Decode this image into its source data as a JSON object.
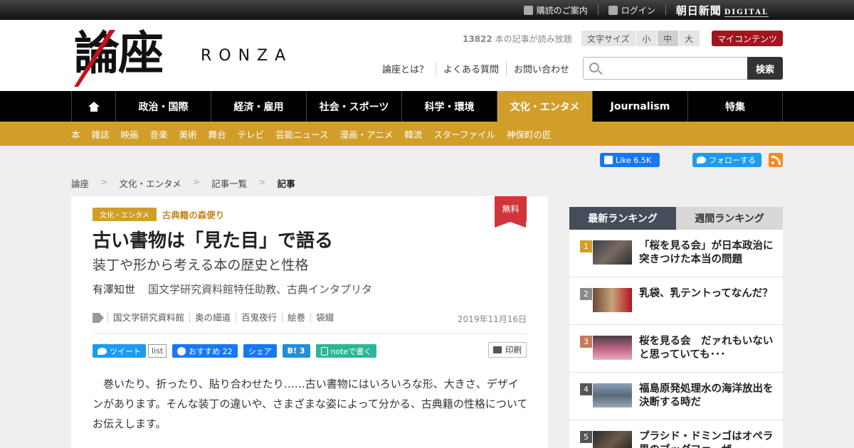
{
  "topbar": {
    "guide": "購読のご案内",
    "login": "ログイン",
    "brand": "朝日新聞",
    "brand_digital": "DIGITAL"
  },
  "header": {
    "logo_kanji": "論座",
    "logo_latin": "RONZA",
    "count_number": "13822",
    "count_text": "本の記事が読み放題",
    "fontsize_label": "文字サイズ",
    "fontsize_small": "小",
    "fontsize_medium": "中",
    "fontsize_large": "大",
    "my_contents": "マイコンテンツ",
    "links": [
      "論座とは？",
      "よくある質問",
      "お問い合わせ"
    ],
    "search_button": "検索",
    "search_placeholder": ""
  },
  "nav": {
    "items": [
      "政治・国際",
      "経済・雇用",
      "社会・スポーツ",
      "科学・環境",
      "文化・エンタメ",
      "Journalism",
      "特集"
    ]
  },
  "subnav": {
    "items": [
      "本",
      "雑誌",
      "映画",
      "音楽",
      "美術",
      "舞台",
      "テレビ",
      "芸能ニュース",
      "漫画・アニメ",
      "韓流",
      "スターファイル",
      "神保町の匠"
    ]
  },
  "social": {
    "fb_like": "Like 6.5K",
    "tw_follow": "フォローする"
  },
  "breadcrumb": [
    "論座",
    "文化・エンタメ",
    "記事一覧",
    "記事"
  ],
  "article": {
    "free_label": "無料",
    "category": "文化・エンタメ",
    "series": "古典籍の森便り",
    "title": "古い書物は「見た目」で語る",
    "subtitle": "装丁や形から考える本の歴史と性格",
    "author": "有澤知世",
    "affiliation": "国文学研究資料館特任助教、古典インタプリタ",
    "tags": [
      "国文学研究資料館",
      "奥の細道",
      "百鬼夜行",
      "絵巻",
      "袋綴"
    ],
    "date": "2019年11月16日",
    "share": {
      "tweet": "ツイート",
      "list": "list",
      "fb_recommend": "おすすめ 22",
      "fb_share": "シェア",
      "hatena": "B! 3",
      "note": "noteで書く",
      "print": "印刷"
    },
    "body": "巻いたり、折ったり、貼り合わせたり……古い書物にはいろいろな形、大きさ、デザインがあります。そんな装丁の違いや、さまざまな姿によって分かる、古典籍の性格についてお伝えします。"
  },
  "ranking": {
    "tab_latest": "最新ランキング",
    "tab_weekly": "週間ランキング",
    "items": [
      {
        "rank": "1",
        "title": "「桜を見る会」が日本政治に突きつけた本当の問題"
      },
      {
        "rank": "2",
        "title": "乳袋、乳テントってなんだ？"
      },
      {
        "rank": "3",
        "title": "桜を見る会　だァれもいないと思っていても･･･"
      },
      {
        "rank": "4",
        "title": "福島原発処理水の海洋放出を決断する時だ"
      },
      {
        "rank": "5",
        "title": "プラシド・ドミンゴはオペラ界のブッダファーザー"
      }
    ]
  },
  "colors": {
    "accent_gold": "#d19e2a",
    "brand_red": "#a0151e",
    "free_red": "#d0353b"
  }
}
